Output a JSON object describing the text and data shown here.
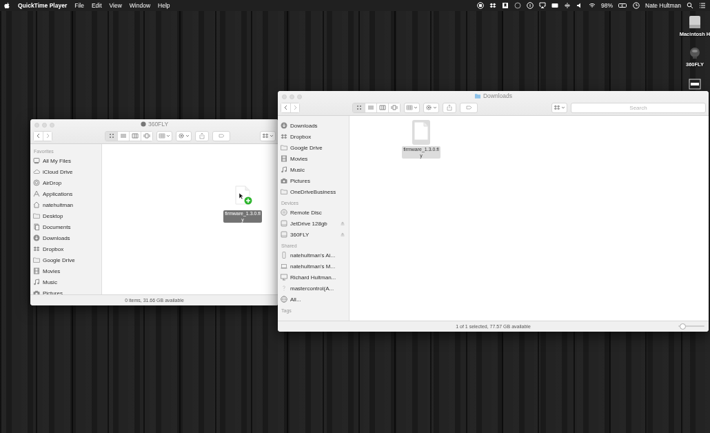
{
  "menu_bar": {
    "app_name": "QuickTime Player",
    "menus": [
      "File",
      "Edit",
      "View",
      "Window",
      "Help"
    ],
    "battery": "98%",
    "user": "Nate Hultman"
  },
  "desktop_icons": [
    {
      "kind": "hard-drive",
      "label": "Macintosh H"
    },
    {
      "kind": "camera",
      "label": "360FLY"
    },
    {
      "kind": "card"
    }
  ],
  "windows": [
    {
      "title": "360FLY",
      "title_icon": {
        "kind": "camera"
      },
      "front": false,
      "sidebar": [
        {
          "heading": "Favorites",
          "items": [
            {
              "label": "All My Files",
              "kind": "files"
            },
            {
              "label": "iCloud Drive",
              "kind": "cloud"
            },
            {
              "label": "AirDrop",
              "kind": "airdrop"
            },
            {
              "label": "Applications",
              "kind": "apps"
            },
            {
              "label": "natehultman",
              "kind": "home"
            },
            {
              "label": "Desktop",
              "kind": "folder"
            },
            {
              "label": "Documents",
              "kind": "documents"
            },
            {
              "label": "Downloads",
              "kind": "downloads"
            },
            {
              "label": "Dropbox",
              "kind": "dropbox"
            },
            {
              "label": "Google Drive",
              "kind": "folder"
            },
            {
              "label": "Movies",
              "kind": "movies"
            },
            {
              "label": "Music",
              "kind": "music"
            },
            {
              "label": "Pictures",
              "kind": "pictures"
            }
          ]
        }
      ],
      "files": [
        {
          "name": "firmware_1.3.0.fly",
          "selected": false,
          "dragging": true
        }
      ],
      "status": "0 items, 31.66 GB available"
    },
    {
      "title": "Downloads",
      "title_icon": {
        "kind": "folder"
      },
      "front": true,
      "search": {
        "placeholder": "Search"
      },
      "sidebar": [
        {
          "items": [
            {
              "label": "Downloads",
              "kind": "downloads"
            },
            {
              "label": "Dropbox",
              "kind": "dropbox"
            },
            {
              "label": "Google Drive",
              "kind": "folder"
            },
            {
              "label": "Movies",
              "kind": "movies"
            },
            {
              "label": "Music",
              "kind": "music"
            },
            {
              "label": "Pictures",
              "kind": "pictures"
            },
            {
              "label": "OneDriveBusiness",
              "kind": "folder"
            }
          ]
        },
        {
          "heading": "Devices",
          "items": [
            {
              "label": "Remote Disc",
              "kind": "disc"
            },
            {
              "label": "JetDrive 128gb",
              "kind": "drive",
              "ejectable": true
            },
            {
              "label": "360FLY",
              "kind": "drive",
              "ejectable": true
            }
          ]
        },
        {
          "heading": "Shared",
          "items": [
            {
              "label": "natehultman's Ai...",
              "kind": "phone"
            },
            {
              "label": "natehultman's M...",
              "kind": "laptop"
            },
            {
              "label": "Richard Hultman...",
              "kind": "monitor"
            },
            {
              "label": "mastercontrol(A...",
              "kind": "unknown"
            },
            {
              "label": "All...",
              "kind": "network"
            }
          ]
        },
        {
          "heading": "Tags"
        }
      ],
      "files": [
        {
          "name": "firmware_1.3.0.fly",
          "selected": true,
          "dragging": false
        }
      ],
      "status": "1 of 1 selected, 77.57 GB available",
      "zoom": {
        "level": 0.15
      }
    }
  ]
}
